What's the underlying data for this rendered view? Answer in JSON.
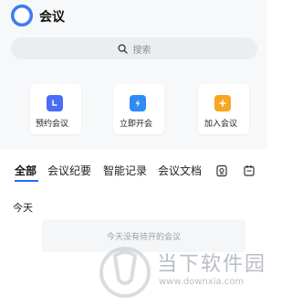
{
  "header": {
    "title": "会议",
    "avatar_icon": "user-avatar-icon"
  },
  "search": {
    "placeholder": "搜索",
    "icon": "search-icon"
  },
  "actions": [
    {
      "label": "预约会议",
      "icon": "calendar-clock-icon",
      "color": "#4b6cf7"
    },
    {
      "label": "立即开会",
      "icon": "video-flash-icon",
      "color": "#2f8cf5"
    },
    {
      "label": "加入会议",
      "icon": "video-plus-icon",
      "color": "#f6a623"
    }
  ],
  "tabs": [
    {
      "label": "全部",
      "active": true
    },
    {
      "label": "会议纪要",
      "active": false
    },
    {
      "label": "智能记录",
      "active": false
    },
    {
      "label": "会议文档",
      "active": false
    }
  ],
  "tab_icons": [
    "ai-record-icon",
    "calendar-icon"
  ],
  "sections": {
    "today": {
      "title": "今天",
      "empty_text": "今天没有待开的会议"
    }
  },
  "watermark": {
    "text": "当下软件园",
    "url": "www.downxia.com"
  },
  "colors": {
    "accent": "#1f6bff",
    "background_top": "#f7f8fa"
  }
}
